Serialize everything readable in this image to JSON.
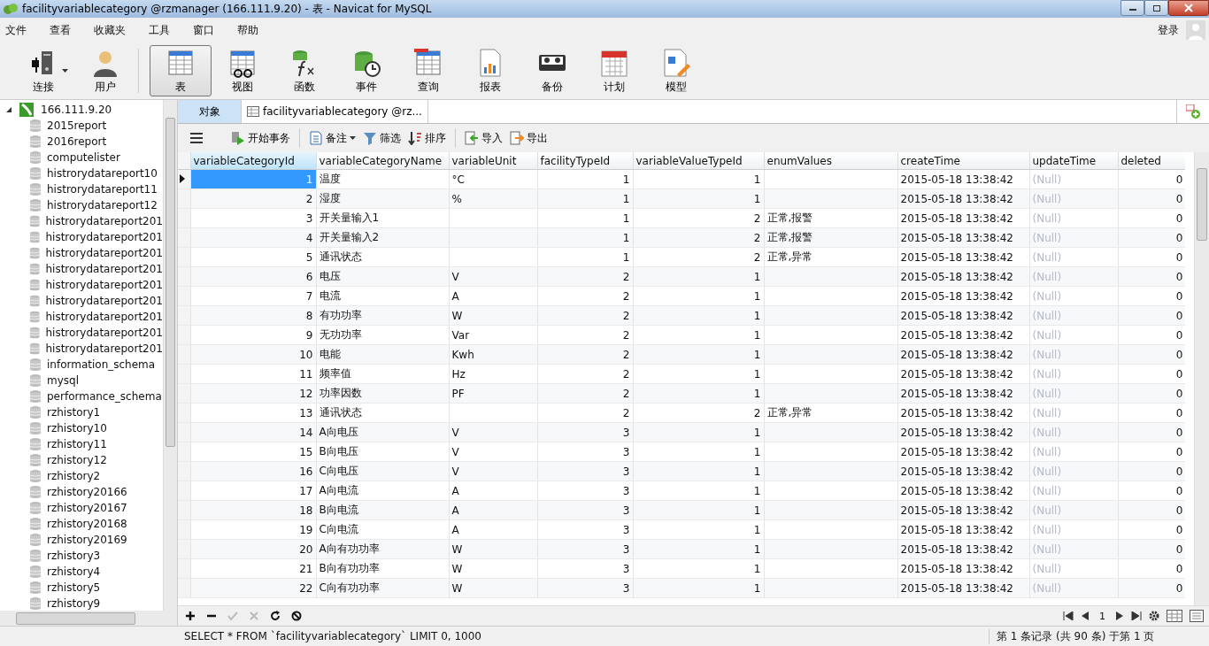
{
  "window": {
    "title": "facilityvariablecategory @rzmanager (166.111.9.20) - 表 - Navicat for MySQL"
  },
  "menu": [
    "文件",
    "查看",
    "收藏夹",
    "工具",
    "窗口",
    "帮助"
  ],
  "login": "登录",
  "toolbar": [
    {
      "label": "连接",
      "selected": false
    },
    {
      "label": "用户",
      "selected": false
    },
    {
      "label": "表",
      "selected": true
    },
    {
      "label": "视图",
      "selected": false
    },
    {
      "label": "函数",
      "selected": false
    },
    {
      "label": "事件",
      "selected": false
    },
    {
      "label": "查询",
      "selected": false
    },
    {
      "label": "报表",
      "selected": false
    },
    {
      "label": "备份",
      "selected": false
    },
    {
      "label": "计划",
      "selected": false
    },
    {
      "label": "模型",
      "selected": false
    }
  ],
  "sidebar": {
    "tree": [
      {
        "label": "166.111.9.20",
        "expanded": true,
        "children": [
          {
            "label": "2015report"
          },
          {
            "label": "2016report"
          },
          {
            "label": "computelister"
          },
          {
            "label": "histrorydatareport10"
          },
          {
            "label": "histrorydatareport11"
          },
          {
            "label": "histrorydatareport12"
          },
          {
            "label": "histrorydatareport201"
          },
          {
            "label": "histrorydatareport201"
          },
          {
            "label": "histrorydatareport201"
          },
          {
            "label": "histrorydatareport201"
          },
          {
            "label": "histrorydatareport201"
          },
          {
            "label": "histrorydatareport201"
          },
          {
            "label": "histrorydatareport201"
          },
          {
            "label": "histrorydatareport201"
          },
          {
            "label": "histrorydatareport201"
          },
          {
            "label": "information_schema"
          },
          {
            "label": "mysql"
          },
          {
            "label": "performance_schema"
          },
          {
            "label": "rzhistory1"
          },
          {
            "label": "rzhistory10"
          },
          {
            "label": "rzhistory11"
          },
          {
            "label": "rzhistory12"
          },
          {
            "label": "rzhistory2"
          },
          {
            "label": "rzhistory20166"
          },
          {
            "label": "rzhistory20167"
          },
          {
            "label": "rzhistory20168"
          },
          {
            "label": "rzhistory20169"
          },
          {
            "label": "rzhistory3"
          },
          {
            "label": "rzhistory4"
          },
          {
            "label": "rzhistory5"
          },
          {
            "label": "rzhistory9"
          }
        ]
      }
    ]
  },
  "tabs": [
    {
      "label": "对象",
      "selected": false
    },
    {
      "label": "facilityvariablecategory @rz...",
      "selected": true
    }
  ],
  "grid_toolbar": [
    {
      "label": "开始事务"
    },
    {
      "label": "备注"
    },
    {
      "label": "筛选"
    },
    {
      "label": "排序"
    },
    {
      "label": "导入"
    },
    {
      "label": "导出"
    }
  ],
  "table": {
    "columns": [
      {
        "name": "variableCategoryId",
        "kind": "number"
      },
      {
        "name": "variableCategoryName",
        "kind": "text"
      },
      {
        "name": "variableUnit",
        "kind": "text"
      },
      {
        "name": "facilityTypeId",
        "kind": "number"
      },
      {
        "name": "variableValueTypeId",
        "kind": "number"
      },
      {
        "name": "enumValues",
        "kind": "text"
      },
      {
        "name": "createTime",
        "kind": "text"
      },
      {
        "name": "updateTime",
        "kind": "null"
      },
      {
        "name": "deleted",
        "kind": "number"
      }
    ],
    "rows": [
      {
        "selected": true,
        "cells": [
          "1",
          "温度",
          "°C",
          "1",
          "1",
          null,
          "2015-05-18 13:38:42",
          "(Null)",
          "0"
        ]
      },
      {
        "selected": false,
        "cells": [
          "2",
          "湿度",
          "%",
          "1",
          "1",
          null,
          "2015-05-18 13:38:42",
          "(Null)",
          "0"
        ]
      },
      {
        "selected": false,
        "cells": [
          "3",
          "开关量输入1",
          null,
          "1",
          "2",
          "正常,报警",
          "2015-05-18 13:38:42",
          "(Null)",
          "0"
        ]
      },
      {
        "selected": false,
        "cells": [
          "4",
          "开关量输入2",
          null,
          "1",
          "2",
          "正常,报警",
          "2015-05-18 13:38:42",
          "(Null)",
          "0"
        ]
      },
      {
        "selected": false,
        "cells": [
          "5",
          "通讯状态",
          null,
          "1",
          "2",
          "正常,异常",
          "2015-05-18 13:38:42",
          "(Null)",
          "0"
        ]
      },
      {
        "selected": false,
        "cells": [
          "6",
          "电压",
          "V",
          "2",
          "1",
          null,
          "2015-05-18 13:38:42",
          "(Null)",
          "0"
        ]
      },
      {
        "selected": false,
        "cells": [
          "7",
          "电流",
          "A",
          "2",
          "1",
          null,
          "2015-05-18 13:38:42",
          "(Null)",
          "0"
        ]
      },
      {
        "selected": false,
        "cells": [
          "8",
          "有功功率",
          "W",
          "2",
          "1",
          null,
          "2015-05-18 13:38:42",
          "(Null)",
          "0"
        ]
      },
      {
        "selected": false,
        "cells": [
          "9",
          "无功功率",
          "Var",
          "2",
          "1",
          null,
          "2015-05-18 13:38:42",
          "(Null)",
          "0"
        ]
      },
      {
        "selected": false,
        "cells": [
          "10",
          "电能",
          "Kwh",
          "2",
          "1",
          null,
          "2015-05-18 13:38:42",
          "(Null)",
          "0"
        ]
      },
      {
        "selected": false,
        "cells": [
          "11",
          "频率值",
          "Hz",
          "2",
          "1",
          null,
          "2015-05-18 13:38:42",
          "(Null)",
          "0"
        ]
      },
      {
        "selected": false,
        "cells": [
          "12",
          "功率因数",
          "PF",
          "2",
          "1",
          null,
          "2015-05-18 13:38:42",
          "(Null)",
          "0"
        ]
      },
      {
        "selected": false,
        "cells": [
          "13",
          "通讯状态",
          null,
          "2",
          "2",
          "正常,异常",
          "2015-05-18 13:38:42",
          "(Null)",
          "0"
        ]
      },
      {
        "selected": false,
        "cells": [
          "14",
          "A向电压",
          "V",
          "3",
          "1",
          null,
          "2015-05-18 13:38:42",
          "(Null)",
          "0"
        ]
      },
      {
        "selected": false,
        "cells": [
          "15",
          "B向电压",
          "V",
          "3",
          "1",
          null,
          "2015-05-18 13:38:42",
          "(Null)",
          "0"
        ]
      },
      {
        "selected": false,
        "cells": [
          "16",
          "C向电压",
          "V",
          "3",
          "1",
          null,
          "2015-05-18 13:38:42",
          "(Null)",
          "0"
        ]
      },
      {
        "selected": false,
        "cells": [
          "17",
          "A向电流",
          "A",
          "3",
          "1",
          null,
          "2015-05-18 13:38:42",
          "(Null)",
          "0"
        ]
      },
      {
        "selected": false,
        "cells": [
          "18",
          "B向电流",
          "A",
          "3",
          "1",
          null,
          "2015-05-18 13:38:42",
          "(Null)",
          "0"
        ]
      },
      {
        "selected": false,
        "cells": [
          "19",
          "C向电流",
          "A",
          "3",
          "1",
          null,
          "2015-05-18 13:38:42",
          "(Null)",
          "0"
        ]
      },
      {
        "selected": false,
        "cells": [
          "20",
          "A向有功功率",
          "W",
          "3",
          "1",
          null,
          "2015-05-18 13:38:42",
          "(Null)",
          "0"
        ]
      },
      {
        "selected": false,
        "cells": [
          "21",
          "B向有功功率",
          "W",
          "3",
          "1",
          null,
          "2015-05-18 13:38:42",
          "(Null)",
          "0"
        ]
      },
      {
        "selected": false,
        "cells": [
          "22",
          "C向有功功率",
          "W",
          "3",
          "1",
          null,
          "2015-05-18 13:38:42",
          "(Null)",
          "0"
        ]
      }
    ]
  },
  "record_actions": [
    {
      "disabled": false
    },
    {
      "disabled": false
    },
    {
      "disabled": true
    },
    {
      "disabled": true
    },
    {
      "disabled": false
    },
    {
      "disabled": false
    }
  ],
  "pager": {
    "page": "1"
  },
  "status_bar": {
    "query": "SELECT * FROM `facilityvariablecategory` LIMIT 0, 1000",
    "records": "第 1 条记录 (共 90 条) 于第 1 页"
  }
}
